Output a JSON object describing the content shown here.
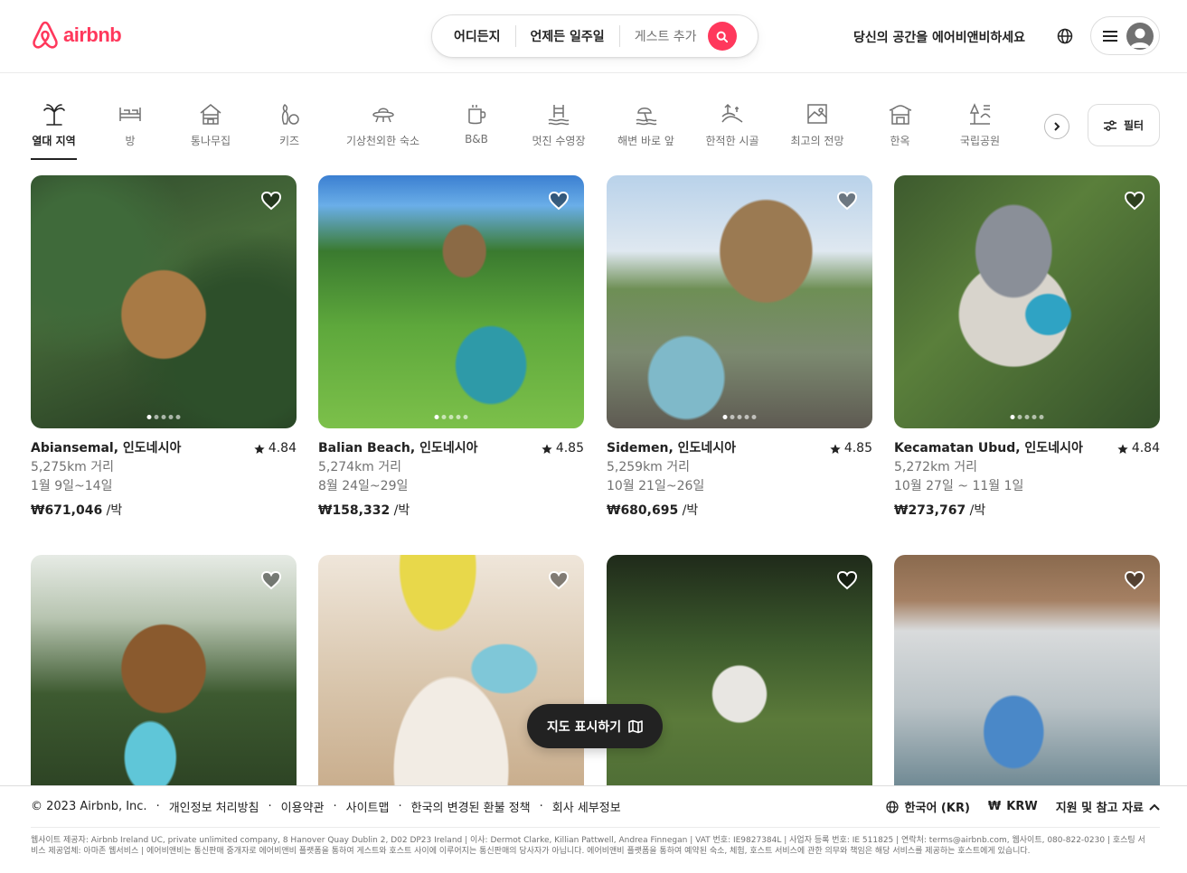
{
  "header": {
    "logo_text": "airbnb",
    "search": {
      "where": "어디든지",
      "when": "언제든 일주일",
      "guests": "게스트 추가"
    },
    "host_link": "당신의 공간을 에어비앤비하세요",
    "brand_color": "#ff385c"
  },
  "categories": [
    {
      "label": "열대 지역",
      "icon": "palm-tree-icon",
      "active": true
    },
    {
      "label": "방",
      "icon": "bed-icon"
    },
    {
      "label": "통나무집",
      "icon": "cabin-icon"
    },
    {
      "label": "키즈",
      "icon": "bowling-icon"
    },
    {
      "label": "기상천외한 숙소",
      "icon": "ufo-icon"
    },
    {
      "label": "B&B",
      "icon": "coffee-mug-icon"
    },
    {
      "label": "멋진 수영장",
      "icon": "pool-icon"
    },
    {
      "label": "해변 바로 앞",
      "icon": "beach-icon"
    },
    {
      "label": "한적한 시골",
      "icon": "countryside-icon"
    },
    {
      "label": "최고의 전망",
      "icon": "view-icon"
    },
    {
      "label": "한옥",
      "icon": "hanok-icon"
    },
    {
      "label": "국립공원",
      "icon": "national-park-icon"
    }
  ],
  "filter_label": "필터",
  "listings": [
    {
      "location": "Abiansemal, 인도네시아",
      "rating": "4.84",
      "distance": "5,275km 거리",
      "dates": "1월 9일~14일",
      "price": "₩671,046",
      "per": " /박"
    },
    {
      "location": "Balian Beach, 인도네시아",
      "rating": "4.85",
      "distance": "5,274km 거리",
      "dates": "8월 24일~29일",
      "price": "₩158,332",
      "per": " /박"
    },
    {
      "location": "Sidemen, 인도네시아",
      "rating": "4.85",
      "distance": "5,259km 거리",
      "dates": "10월 21일~26일",
      "price": "₩680,695",
      "per": " /박"
    },
    {
      "location": "Kecamatan Ubud, 인도네시아",
      "rating": "4.84",
      "distance": "5,272km 거리",
      "dates": "10월 27일 ~ 11월 1일",
      "price": "₩273,767",
      "per": " /박"
    }
  ],
  "map_button": "지도 표시하기",
  "footer": {
    "copyright": "© 2023 Airbnb, Inc.",
    "links": [
      "개인정보 처리방침",
      "이용약관",
      "사이트맵",
      "한국의 변경된 환불 정책",
      "회사 세부정보"
    ],
    "language": "한국어 (KR)",
    "currency_symbol": "₩",
    "currency": "KRW",
    "support": "지원 및 참고 자료",
    "legal": "웹사이트 제공자: Airbnb Ireland UC, private unlimited company, 8 Hanover Quay Dublin 2, D02 DP23 Ireland | 이사: Dermot Clarke, Killian Pattwell, Andrea Finnegan | VAT 번호: IE9827384L | 사업자 등록 번호: IE 511825 | 연락처: terms@airbnb.com, 웹사이트, 080-822-0230 | 호스팅 서비스 제공업체: 아마존 웹서비스 | 에어비앤비는 통신판매 중개자로 에어비앤비 플랫폼을 통하여 게스트와 호스트 사이에 이루어지는 통신판매의 당사자가 아닙니다. 에어비앤비 플랫폼을 통하여 예약된 숙소, 체험, 호스트 서비스에 관한 의무와 책임은 해당 서비스를 제공하는 호스트에게 있습니다."
  }
}
